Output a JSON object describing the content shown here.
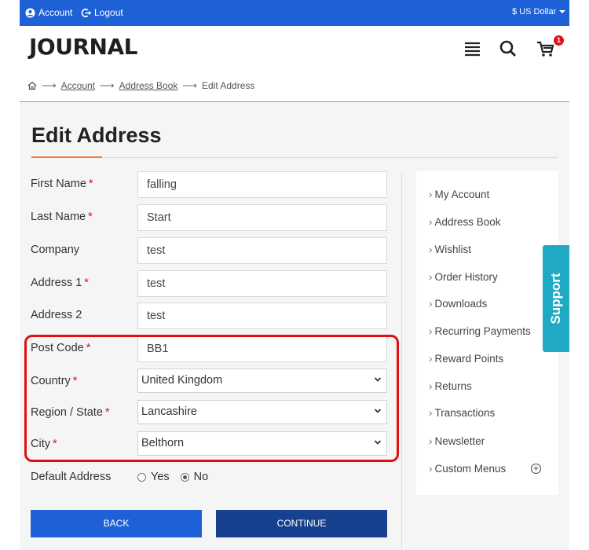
{
  "topbar": {
    "account": "Account",
    "logout": "Logout",
    "currency": "$ US Dollar"
  },
  "header": {
    "logo": "JOURNAL",
    "cart_count": "1"
  },
  "breadcrumb": {
    "items": [
      "Account",
      "Address Book",
      "Edit Address"
    ]
  },
  "page": {
    "title": "Edit Address"
  },
  "form": {
    "first_name": {
      "label": "First Name",
      "value": "falling"
    },
    "last_name": {
      "label": "Last Name",
      "value": "Start"
    },
    "company": {
      "label": "Company",
      "value": "test"
    },
    "address1": {
      "label": "Address 1",
      "value": "test"
    },
    "address2": {
      "label": "Address 2",
      "value": "test"
    },
    "postcode": {
      "label": "Post Code",
      "value": "BB1"
    },
    "country": {
      "label": "Country",
      "value": "United Kingdom"
    },
    "region": {
      "label": "Region / State",
      "value": "Lancashire"
    },
    "city": {
      "label": "City",
      "value": "Belthorn"
    },
    "default_address": {
      "label": "Default Address",
      "yes": "Yes",
      "no": "No",
      "selected": "No"
    }
  },
  "buttons": {
    "back": "BACK",
    "continue": "CONTINUE"
  },
  "sidebar": {
    "items": [
      "My Account",
      "Address Book",
      "Wishlist",
      "Order History",
      "Downloads",
      "Recurring Payments",
      "Reward Points",
      "Returns",
      "Transactions",
      "Newsletter",
      "Custom Menus"
    ]
  },
  "support": {
    "label": "Support"
  },
  "colors": {
    "topbar": "#1e61d6",
    "accent": "#e8833a",
    "continue": "#17418e",
    "support": "#1fa9c5",
    "highlight": "#e01010"
  }
}
